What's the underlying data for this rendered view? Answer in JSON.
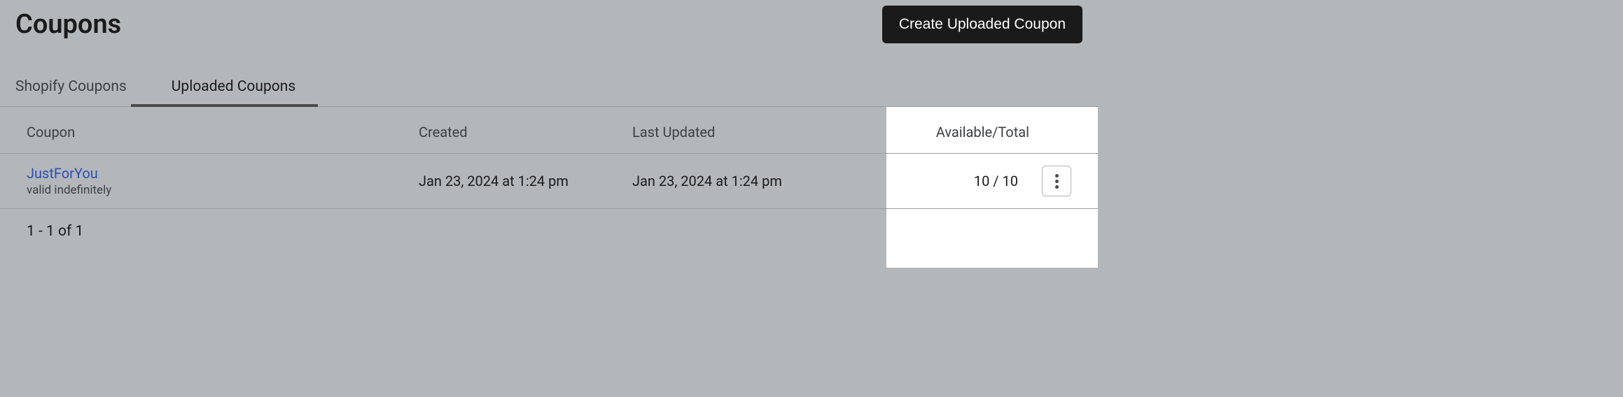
{
  "header": {
    "title": "Coupons",
    "create_button": "Create Uploaded Coupon"
  },
  "tabs": [
    {
      "label": "Shopify Coupons",
      "active": false
    },
    {
      "label": "Uploaded Coupons",
      "active": true
    }
  ],
  "table": {
    "columns": {
      "coupon": "Coupon",
      "created": "Created",
      "last_updated": "Last Updated",
      "available_total": "Available/Total"
    },
    "rows": [
      {
        "name": "JustForYou",
        "validity": "valid indefinitely",
        "created": "Jan 23, 2024 at 1:24 pm",
        "last_updated": "Jan 23, 2024 at 1:24 pm",
        "available_total": "10 / 10"
      }
    ]
  },
  "pagination": "1 - 1 of 1"
}
